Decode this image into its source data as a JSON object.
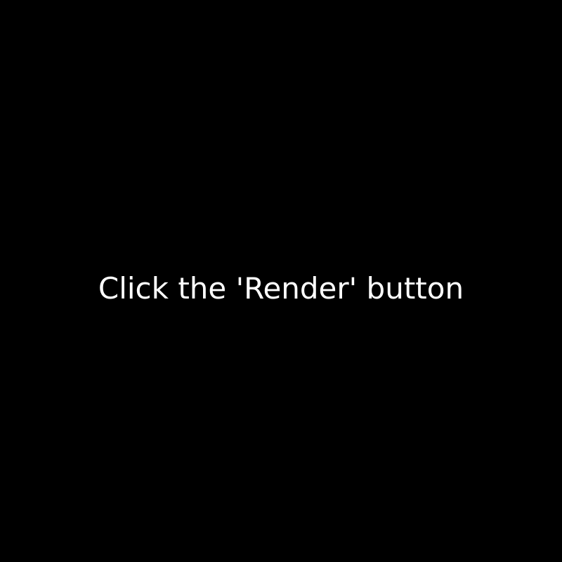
{
  "instruction": {
    "text": "Click the 'Render' button"
  },
  "colors": {
    "background": "#000000",
    "text": "#ffffff"
  }
}
